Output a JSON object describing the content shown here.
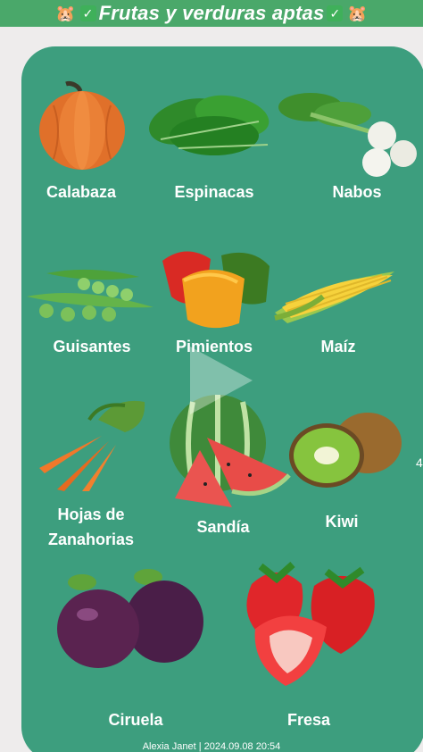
{
  "header": {
    "emoji_left": "🐹",
    "check_left": "✓",
    "title": "Frutas y verduras aptas",
    "check_right": "✓",
    "emoji_right": "🐹"
  },
  "items": [
    {
      "label": "Calabaza",
      "icon": "pumpkin-icon"
    },
    {
      "label": "Espinacas",
      "icon": "spinach-icon"
    },
    {
      "label": "Nabos",
      "icon": "turnip-icon"
    },
    {
      "label": "Guisantes",
      "icon": "peas-icon"
    },
    {
      "label": "Pimientos",
      "icon": "peppers-icon"
    },
    {
      "label": "Maíz",
      "icon": "corn-icon"
    },
    {
      "label": "Hojas de",
      "label2": "Zanahorias",
      "icon": "carrot-icon"
    },
    {
      "label": "Sandía",
      "icon": "watermelon-icon"
    },
    {
      "label": "Kiwi",
      "icon": "kiwi-icon"
    },
    {
      "label": "Ciruela",
      "icon": "plum-icon"
    },
    {
      "label": "Fresa",
      "icon": "strawberry-icon"
    }
  ],
  "footer": {
    "text": "Alexia Janet | 2024.09.08 20:54"
  },
  "edge_mark": "4",
  "colors": {
    "card": "#3d9e7e",
    "title_bar": "#4aa86a",
    "background": "#eeecec"
  }
}
